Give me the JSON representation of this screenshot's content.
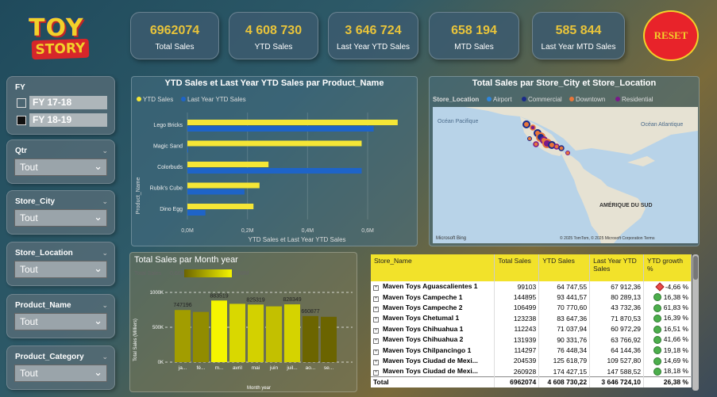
{
  "logo": {
    "line1": "TOY",
    "line2": "STORY"
  },
  "kpis": [
    {
      "value": "6962074",
      "label": "Total Sales"
    },
    {
      "value": "4 608 730",
      "label": "YTD Sales"
    },
    {
      "value": "3 646 724",
      "label": "Last Year YTD Sales"
    },
    {
      "value": "658 194",
      "label": "MTD Sales"
    },
    {
      "value": "585 844",
      "label": "Last Year MTD Sales"
    }
  ],
  "reset_label": "RESET",
  "slicers": {
    "fy": {
      "title": "FY",
      "options": [
        "FY 17-18",
        "FY 18-19"
      ]
    },
    "qtr": {
      "title": "Qtr",
      "value": "Tout"
    },
    "store_city": {
      "title": "Store_City",
      "value": "Tout"
    },
    "store_location": {
      "title": "Store_Location",
      "value": "Tout"
    },
    "product_name": {
      "title": "Product_Name",
      "value": "Tout"
    },
    "product_category": {
      "title": "Product_Category",
      "value": "Tout"
    }
  },
  "bar_panel": {
    "title": "YTD Sales et Last Year YTD Sales par Product_Name",
    "legend": [
      "YTD Sales",
      "Last Year YTD Sales"
    ],
    "ylabel": "Product_Name",
    "xlabel": "YTD Sales et Last Year YTD Sales",
    "xticks": [
      "0,0M",
      "0,2M",
      "0,4M",
      "0,6M"
    ]
  },
  "map_panel": {
    "title": "Total Sales par Store_City et Store_Location",
    "legend_title": "Store_Location",
    "legend": [
      "Airport",
      "Commercial",
      "Downtown",
      "Residential"
    ],
    "labels": {
      "pacific": "Océan Pacifique",
      "atlantic": "Océan Atlantique",
      "sa": "AMÉRIQUE DU SUD"
    },
    "credit": "© 2025 TomTom, © 2025 Microsoft Corporation  Terms",
    "bing": "Microsoft Bing"
  },
  "month_panel": {
    "title": "Total Sales par Month year",
    "legend_title": "Total Sales",
    "legend_min": "0,66M",
    "legend_max": "0,88M",
    "ylabel": "Total Sales (Milliers)",
    "xlabel": "Month year",
    "yticks": [
      "1000K",
      "500K",
      "0K"
    ]
  },
  "table": {
    "headers": [
      "Store_Name",
      "Total Sales",
      "YTD Sales",
      "Last Year YTD Sales",
      "YTD growth %"
    ],
    "rows": [
      {
        "name": "Maven Toys Aguascalientes 1",
        "total": "99103",
        "ytd": "64 747,55",
        "ly": "67 912,36",
        "growth": "-4,66 %",
        "ind": "red"
      },
      {
        "name": "Maven Toys Campeche 1",
        "total": "144895",
        "ytd": "93 441,57",
        "ly": "80 289,13",
        "growth": "16,38 %",
        "ind": "green"
      },
      {
        "name": "Maven Toys Campeche 2",
        "total": "106499",
        "ytd": "70 770,60",
        "ly": "43 732,36",
        "growth": "61,83 %",
        "ind": "green"
      },
      {
        "name": "Maven Toys Chetumal 1",
        "total": "123238",
        "ytd": "83 647,36",
        "ly": "71 870,53",
        "growth": "16,39 %",
        "ind": "green"
      },
      {
        "name": "Maven Toys Chihuahua 1",
        "total": "112243",
        "ytd": "71 037,94",
        "ly": "60 972,29",
        "growth": "16,51 %",
        "ind": "green"
      },
      {
        "name": "Maven Toys Chihuahua 2",
        "total": "131939",
        "ytd": "90 331,76",
        "ly": "63 766,92",
        "growth": "41,66 %",
        "ind": "green"
      },
      {
        "name": "Maven Toys Chilpancingo 1",
        "total": "114297",
        "ytd": "76 448,34",
        "ly": "64 144,36",
        "growth": "19,18 %",
        "ind": "green"
      },
      {
        "name": "Maven Toys Ciudad de Mexi...",
        "total": "204539",
        "ytd": "125 618,79",
        "ly": "109 527,80",
        "growth": "14,69 %",
        "ind": "green"
      },
      {
        "name": "Maven Toys Ciudad de Mexi...",
        "total": "260928",
        "ytd": "174 427,15",
        "ly": "147 588,52",
        "growth": "18,18 %",
        "ind": "green"
      }
    ],
    "total": {
      "name": "Total",
      "total": "6962074",
      "ytd": "4 608 730,22",
      "ly": "3 646 724,10",
      "growth": "26,38 %"
    }
  },
  "chart_data": [
    {
      "type": "bar",
      "orientation": "horizontal",
      "title": "YTD Sales et Last Year YTD Sales par Product_Name",
      "categories": [
        "Lego Bricks",
        "Magic Sand",
        "Colorbuds",
        "Rubik's Cube",
        "Dino Egg"
      ],
      "series": [
        {
          "name": "YTD Sales",
          "color": "#f5e636",
          "values": [
            0.7,
            0.58,
            0.27,
            0.24,
            0.22
          ]
        },
        {
          "name": "Last Year YTD Sales",
          "color": "#1e64c8",
          "values": [
            0.62,
            0.0,
            0.58,
            0.19,
            0.06
          ]
        }
      ],
      "xlim": [
        0,
        0.74
      ],
      "xlabel": "YTD Sales et Last Year YTD Sales",
      "ylabel": "Product_Name"
    },
    {
      "type": "bar",
      "title": "Total Sales par Month year",
      "categories": [
        "ja...",
        "fé...",
        "m...",
        "avril",
        "mai",
        "juin",
        "juil...",
        "ao...",
        "se..."
      ],
      "values": [
        747196,
        720000,
        883519,
        836000,
        825319,
        800000,
        828349,
        660877,
        650000
      ],
      "data_labels": {
        "0": "747196",
        "2": "883519",
        "4": "825319",
        "6": "828349",
        "7": "660877"
      },
      "ylim": [
        0,
        1000000
      ],
      "color_scale": {
        "min": 660000,
        "max": 880000,
        "min_color": "#6b6400",
        "max_color": "#f5f500"
      },
      "ylabel": "Total Sales (Milliers)",
      "xlabel": "Month year"
    }
  ]
}
